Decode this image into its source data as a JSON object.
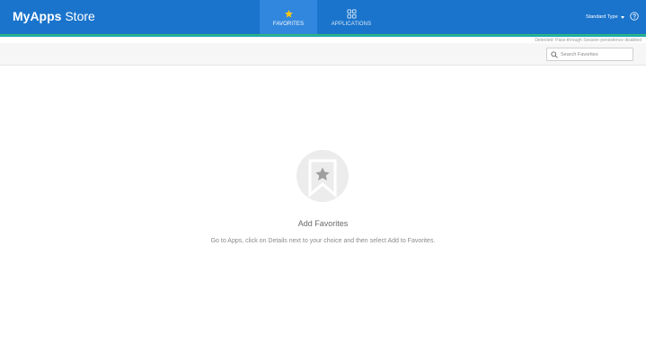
{
  "app": {
    "brand_bold": "MyApps",
    "brand_rest": "Store"
  },
  "nav": {
    "tabs": [
      {
        "label": "FAVORITES",
        "icon": "star-icon",
        "active": true
      },
      {
        "label": "APPLICATIONS",
        "icon": "grid-icon",
        "active": false
      }
    ]
  },
  "user": {
    "name": "Standard Type"
  },
  "status": {
    "text": "Detected: Pass-through Session persistence disabled"
  },
  "search": {
    "placeholder": "Search Favorites",
    "value": ""
  },
  "empty": {
    "title": "Add Favorites",
    "description": "Go to Apps, click on Details next to your choice and then select Add to Favorites."
  },
  "colors": {
    "header": "#1a74cc",
    "active_tab": "#3187dd",
    "star": "#f5c518",
    "stripe_green": "#2eb872",
    "stripe_teal": "#1fa3b8"
  }
}
